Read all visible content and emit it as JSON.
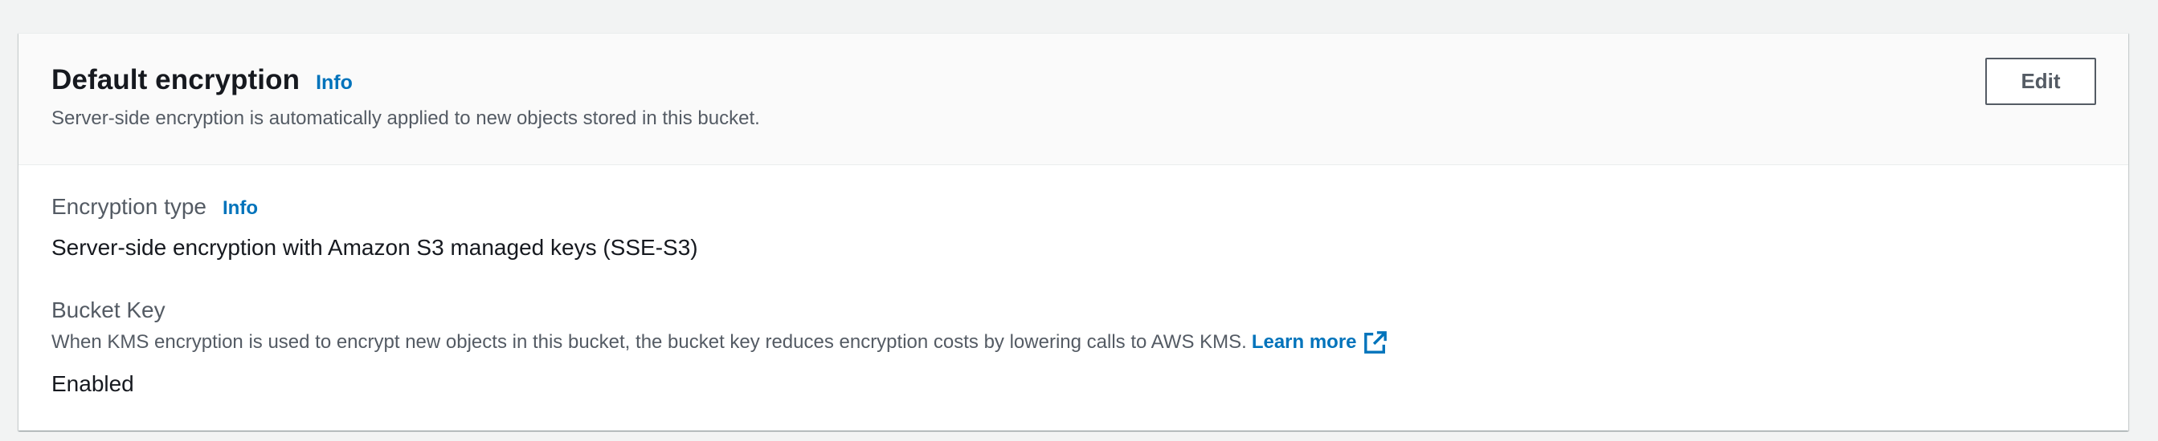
{
  "panel": {
    "title": "Default encryption",
    "title_info": "Info",
    "description": "Server-side encryption is automatically applied to new objects stored in this bucket.",
    "edit_label": "Edit"
  },
  "encryption_type": {
    "label": "Encryption type",
    "info": "Info",
    "value": "Server-side encryption with Amazon S3 managed keys (SSE-S3)"
  },
  "bucket_key": {
    "label": "Bucket Key",
    "description": "When KMS encryption is used to encrypt new objects in this bucket, the bucket key reduces encryption costs by lowering calls to AWS KMS.",
    "learn_more": "Learn more",
    "learn_more_icon": "external-link-icon",
    "value": "Enabled"
  },
  "colors": {
    "link": "#0073bb",
    "text_primary": "#16191f",
    "text_secondary": "#545b64",
    "header_bg": "#fafafa",
    "page_bg": "#f2f3f3"
  }
}
